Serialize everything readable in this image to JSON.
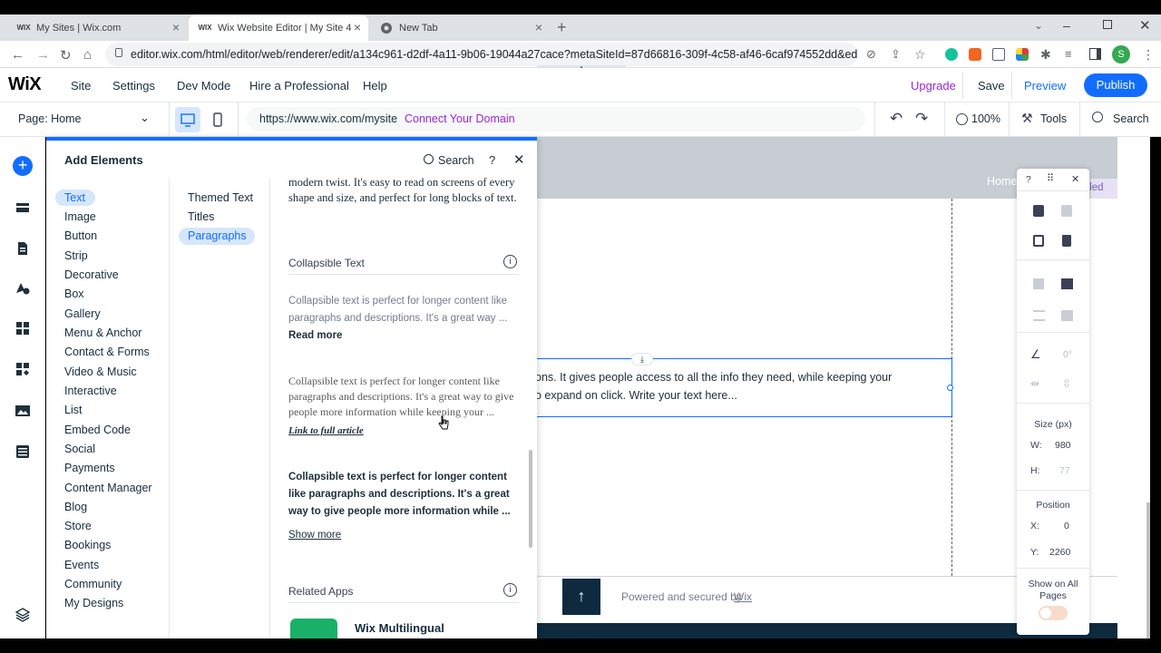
{
  "browser": {
    "tabs": [
      {
        "label": "My Sites | Wix.com",
        "favicon": "WIX"
      },
      {
        "label": "Wix Website Editor | My Site 4",
        "favicon": "WIX"
      },
      {
        "label": "New Tab",
        "favicon": "chrome"
      }
    ],
    "url": "editor.wix.com/html/editor/web/renderer/edit/a134c961-d2df-4a11-9b06-19044a27cace?metaSiteId=87d66816-309f-4c58-af46-6caf974552dd&editorSe...",
    "profile_initial": "S"
  },
  "wix": {
    "logo": "WiX",
    "menu": [
      "Site",
      "Settings",
      "Dev Mode",
      "Hire a Professional",
      "Help"
    ],
    "upgrade": "Upgrade",
    "save": "Save",
    "preview": "Preview",
    "publish": "Publish",
    "page_select": "Page: Home",
    "site_url": "https://www.wix.com/mysite",
    "connect_domain": "Connect Your Domain",
    "zoom": "100%",
    "tools": "Tools",
    "search": "Search"
  },
  "panel": {
    "title": "Add Elements",
    "search": "Search",
    "help": "?",
    "categories": [
      "Text",
      "Image",
      "Button",
      "Strip",
      "Decorative",
      "Box",
      "Gallery",
      "Menu & Anchor",
      "Contact & Forms",
      "Video & Music",
      "Interactive",
      "List",
      "Embed Code",
      "Social",
      "Payments",
      "Content Manager",
      "Blog",
      "Store",
      "Bookings",
      "Events",
      "Community",
      "My Designs"
    ],
    "subcategories": [
      "Themed Text",
      "Titles",
      "Paragraphs"
    ],
    "top_paragraph": "modern twist. It's easy to read on screens of every shape and size, and perfect for long blocks of text.",
    "collapsible_heading": "Collapsible Text",
    "collapsible_1": "Collapsible text is perfect for longer content like paragraphs and descriptions. It's a great way ...",
    "collapsible_1_link": "Read more",
    "collapsible_2": "Collapsible text is perfect for longer content like paragraphs and descriptions. It's a great way to give people more information while keeping your ...",
    "collapsible_2_link": "Link to full article",
    "collapsible_3": "Collapsible text is perfect for longer content like paragraphs and descriptions. It's a great way to give people more information while ...",
    "collapsible_3_link": "Show more",
    "related_heading": "Related Apps",
    "related_app": "Wix Multilingual"
  },
  "canvas": {
    "nav_home": "Home",
    "nav_untitled": "tled",
    "selected_text_line1": "ons. It gives people access to all the info they need, while keeping your",
    "selected_text_line2": "o expand on click. Write your text here...",
    "footer_text": "Powered and secured by",
    "footer_link": "Wix"
  },
  "inspector": {
    "help": "?",
    "angle": "0°",
    "size_label": "Size (px)",
    "w_label": "W:",
    "w_value": "980",
    "h_label": "H:",
    "h_value": "77",
    "position_label": "Position",
    "x_label": "X:",
    "x_value": "0",
    "y_label": "Y:",
    "y_value": "2260",
    "show_all_pages": "Show on All Pages"
  },
  "colors": {
    "accent": "#116dff",
    "upgrade": "#9a27d5",
    "selected_cat_bg": "#d6e6fe"
  }
}
